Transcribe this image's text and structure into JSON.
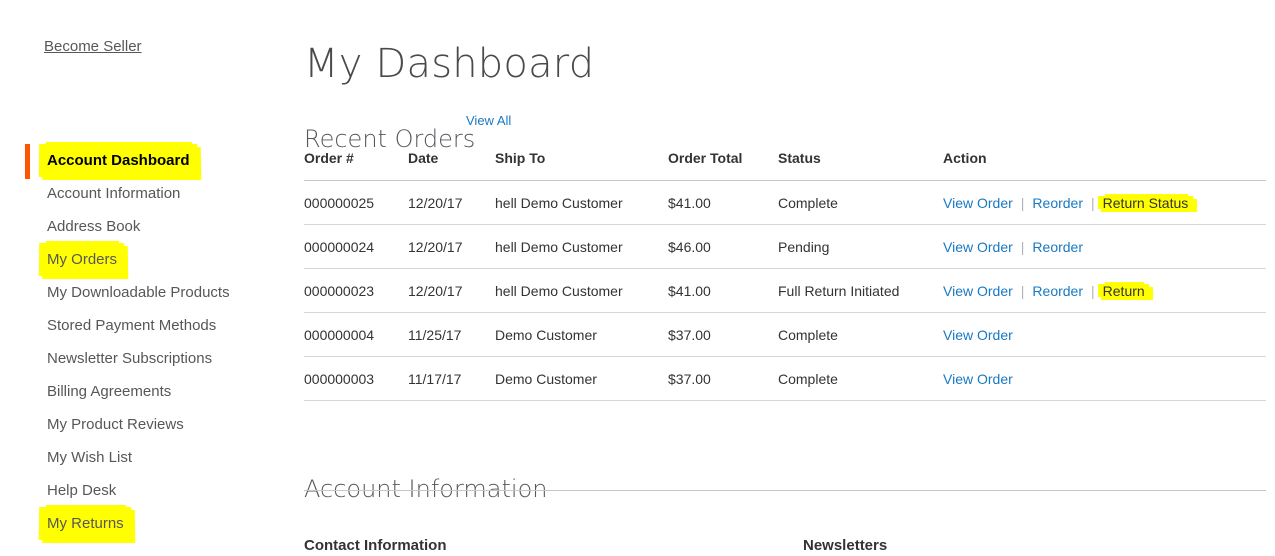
{
  "colors": {
    "highlight": "#ffff00",
    "current_marker": "#ff5501",
    "link": "#1979c3",
    "text": "#333333",
    "muted_text": "#575757",
    "rule": "#c6c6c6"
  },
  "sidebar": {
    "become_seller": "Become Seller",
    "items": [
      {
        "label": "Account Dashboard",
        "current": true,
        "highlighted": true
      },
      {
        "label": "Account Information",
        "current": false,
        "highlighted": false
      },
      {
        "label": "Address Book",
        "current": false,
        "highlighted": false
      },
      {
        "label": "My Orders",
        "current": false,
        "highlighted": true
      },
      {
        "label": "My Downloadable Products",
        "current": false,
        "highlighted": false
      },
      {
        "label": "Stored Payment Methods",
        "current": false,
        "highlighted": false
      },
      {
        "label": "Newsletter Subscriptions",
        "current": false,
        "highlighted": false
      },
      {
        "label": "Billing Agreements",
        "current": false,
        "highlighted": false
      },
      {
        "label": "My Product Reviews",
        "current": false,
        "highlighted": false
      },
      {
        "label": "My Wish List",
        "current": false,
        "highlighted": false
      },
      {
        "label": "Help Desk",
        "current": false,
        "highlighted": false
      },
      {
        "label": "My Returns",
        "current": false,
        "highlighted": true
      }
    ]
  },
  "main": {
    "page_title": "My Dashboard",
    "recent_orders": {
      "heading": "Recent Orders",
      "view_all_label": "View All",
      "columns": [
        "Order #",
        "Date",
        "Ship To",
        "Order Total",
        "Status",
        "Action"
      ],
      "rows": [
        {
          "order": "000000025",
          "date": "12/20/17",
          "ship_to": "hell Demo Customer",
          "total": "$41.00",
          "status": "Complete",
          "actions": [
            {
              "label": "View Order",
              "type": "link",
              "highlighted": false
            },
            {
              "label": "Reorder",
              "type": "link",
              "highlighted": false
            },
            {
              "label": "Return Status",
              "type": "link",
              "highlighted": true
            }
          ]
        },
        {
          "order": "000000024",
          "date": "12/20/17",
          "ship_to": "hell Demo Customer",
          "total": "$46.00",
          "status": "Pending",
          "actions": [
            {
              "label": "View Order",
              "type": "link",
              "highlighted": false
            },
            {
              "label": "Reorder",
              "type": "link",
              "highlighted": false
            }
          ]
        },
        {
          "order": "000000023",
          "date": "12/20/17",
          "ship_to": "hell Demo Customer",
          "total": "$41.00",
          "status": "Full Return Initiated",
          "actions": [
            {
              "label": "View Order",
              "type": "link",
              "highlighted": false
            },
            {
              "label": "Reorder",
              "type": "link",
              "highlighted": false
            },
            {
              "label": "Return",
              "type": "link",
              "highlighted": true
            }
          ]
        },
        {
          "order": "000000004",
          "date": "11/25/17",
          "ship_to": "Demo Customer",
          "total": "$37.00",
          "status": "Complete",
          "actions": [
            {
              "label": "View Order",
              "type": "link",
              "highlighted": false
            }
          ]
        },
        {
          "order": "000000003",
          "date": "11/17/17",
          "ship_to": "Demo Customer",
          "total": "$37.00",
          "status": "Complete",
          "actions": [
            {
              "label": "View Order",
              "type": "link",
              "highlighted": false
            }
          ]
        }
      ]
    },
    "account_information": {
      "heading": "Account Information",
      "contact_information_heading": "Contact Information",
      "newsletters_heading": "Newsletters"
    }
  }
}
